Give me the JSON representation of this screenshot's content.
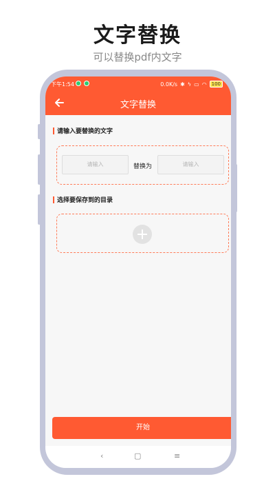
{
  "hero": {
    "title": "文字替换",
    "subtitle": "可以替换pdf内文字"
  },
  "status_bar": {
    "time": "下午1:54",
    "net_speed": "0.0K/s",
    "battery": "100"
  },
  "header": {
    "title": "文字替换",
    "back_icon": "arrow-left-icon"
  },
  "replace_section": {
    "label": "请输入要替换的文字",
    "from_placeholder": "请输入",
    "to_placeholder": "请输入",
    "middle_label": "替换为"
  },
  "directory_section": {
    "label": "选择要保存到的目录",
    "add_icon": "plus-circle-icon"
  },
  "start_button": "开始",
  "system_nav": {
    "back": "‹",
    "home": "▢",
    "menu": "≡"
  },
  "colors": {
    "accent": "#ff5a32",
    "frame": "#c3c6da"
  }
}
